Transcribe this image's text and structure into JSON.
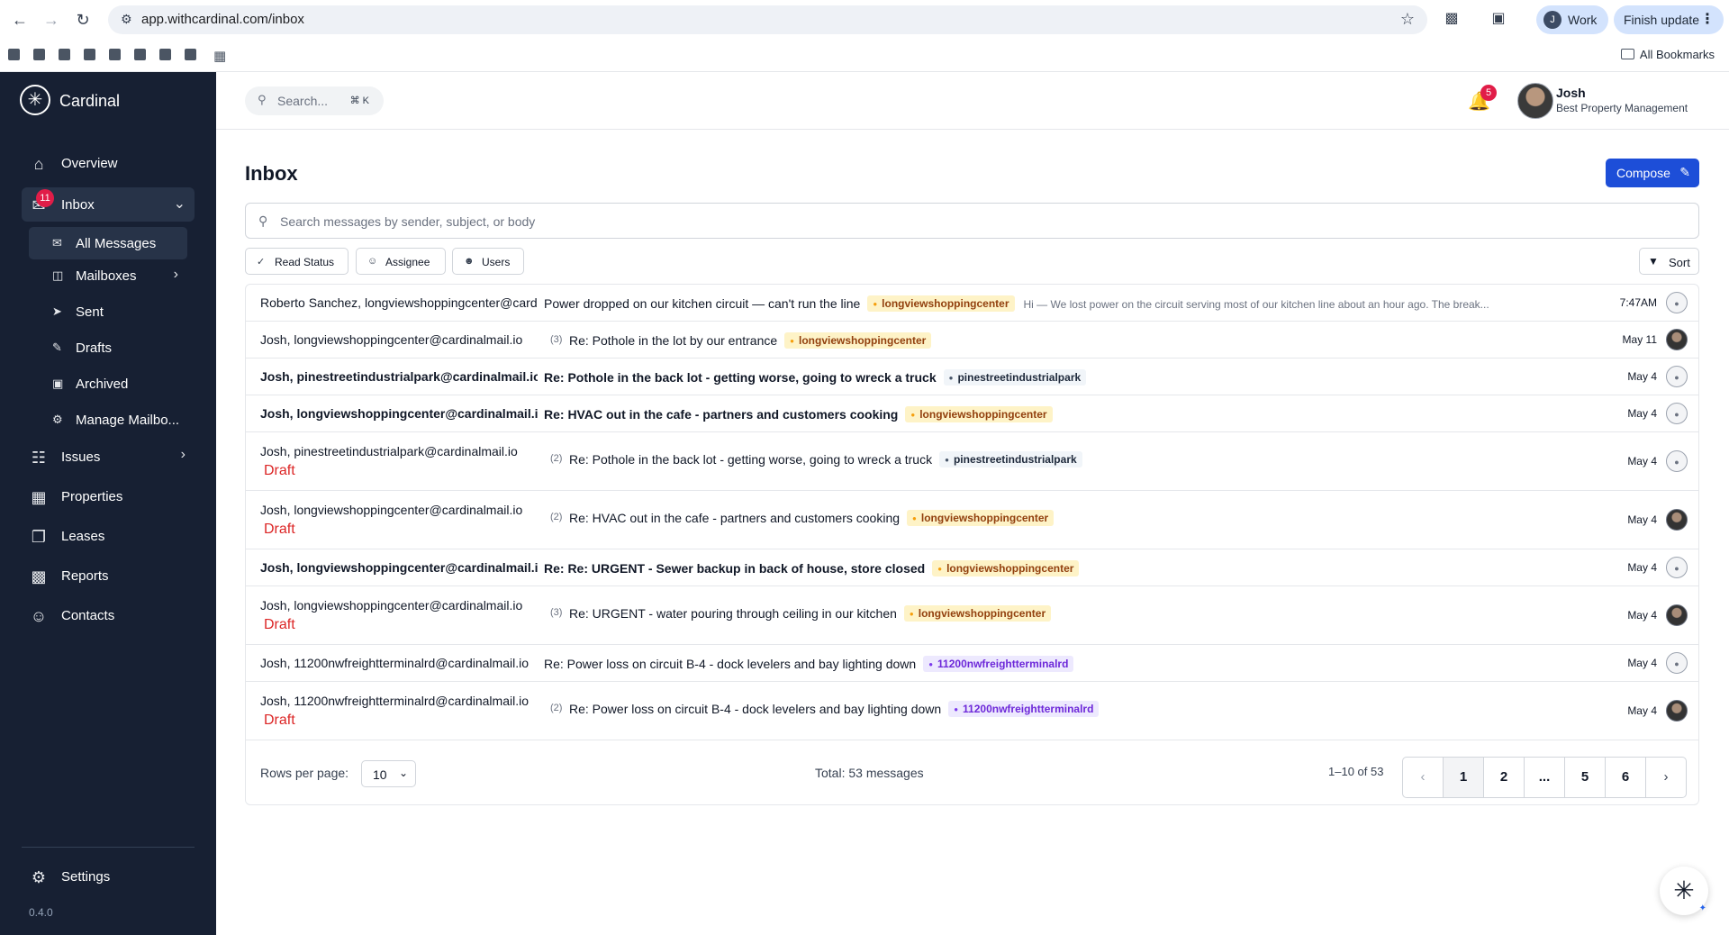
{
  "browser": {
    "url": "app.withcardinal.com/inbox",
    "profile_initial": "J",
    "profile_label": "Work",
    "update_label": "Finish update",
    "all_bookmarks": "All Bookmarks"
  },
  "sidebar": {
    "brand": "Cardinal",
    "overview": "Overview",
    "inbox": "Inbox",
    "inbox_badge": "11",
    "sub": {
      "all_messages": "All Messages",
      "mailboxes": "Mailboxes",
      "sent": "Sent",
      "drafts": "Drafts",
      "archived": "Archived",
      "manage": "Manage Mailbo..."
    },
    "issues": "Issues",
    "properties": "Properties",
    "leases": "Leases",
    "reports": "Reports",
    "contacts": "Contacts",
    "settings": "Settings",
    "version": "0.4.0"
  },
  "header": {
    "search_placeholder": "Search...",
    "shortcut": "⌘ K",
    "notif_count": "5",
    "user_name": "Josh",
    "user_org": "Best Property Management"
  },
  "inbox": {
    "title": "Inbox",
    "compose": "Compose",
    "search_placeholder": "Search messages by sender, subject, or body",
    "filters": {
      "read_status": "Read Status",
      "assignee": "Assignee",
      "users": "Users"
    },
    "sort": "Sort",
    "draft_label": "Draft",
    "messages": [
      {
        "sender": "Roberto Sanchez, longviewshoppingcenter@cardinalmail.io",
        "count": "",
        "subject": "Power dropped on our kitchen circuit — can't run the line",
        "tag": "longviewshoppingcenter",
        "preview": "Hi — We lost power on the circuit serving most of our kitchen line about an hour ago. The break...",
        "date": "7:47AM"
      },
      {
        "sender": "Josh, longviewshoppingcenter@cardinalmail.io",
        "count": "(3)",
        "subject": "Re: Pothole in the lot by our entrance",
        "tag": "longviewshoppingcenter",
        "preview": "",
        "date": "May 11"
      },
      {
        "sender": "Josh, pinestreetindustrialpark@cardinalmail.io",
        "count": "",
        "subject": "Re: Pothole in the back lot - getting worse, going to wreck a truck",
        "tag": "pinestreetindustrialpark",
        "preview": "",
        "date": "May 4"
      },
      {
        "sender": "Josh, longviewshoppingcenter@cardinalmail.io",
        "count": "",
        "subject": "Re: HVAC out in the cafe - partners and customers cooking",
        "tag": "longviewshoppingcenter",
        "preview": "",
        "date": "May 4"
      },
      {
        "sender": "Josh, pinestreetindustrialpark@cardinalmail.io",
        "count": "(2)",
        "subject": "Re: Pothole in the back lot - getting worse, going to wreck a truck",
        "tag": "pinestreetindustrialpark",
        "preview": "",
        "date": "May 4"
      },
      {
        "sender": "Josh, longviewshoppingcenter@cardinalmail.io",
        "count": "(2)",
        "subject": "Re: HVAC out in the cafe - partners and customers cooking",
        "tag": "longviewshoppingcenter",
        "preview": "",
        "date": "May 4"
      },
      {
        "sender": "Josh, longviewshoppingcenter@cardinalmail.io",
        "count": "",
        "subject": "Re: Re: URGENT - Sewer backup in back of house, store closed",
        "tag": "longviewshoppingcenter",
        "preview": "",
        "date": "May 4"
      },
      {
        "sender": "Josh, longviewshoppingcenter@cardinalmail.io",
        "count": "(3)",
        "subject": "Re: URGENT - water pouring through ceiling in our kitchen",
        "tag": "longviewshoppingcenter",
        "preview": "",
        "date": "May 4"
      },
      {
        "sender": "Josh, 11200nwfreightterminalrd@cardinalmail.io",
        "count": "",
        "subject": "Re: Power loss on circuit B-4 - dock levelers and bay lighting down",
        "tag": "11200nwfreightterminalrd",
        "preview": "",
        "date": "May 4"
      },
      {
        "sender": "Josh, 11200nwfreightterminalrd@cardinalmail.io",
        "count": "(2)",
        "subject": "Re: Power loss on circuit B-4 - dock levelers and bay lighting down",
        "tag": "11200nwfreightterminalrd",
        "preview": "",
        "date": "May 4"
      }
    ],
    "footer": {
      "rows_per_page_label": "Rows per page:",
      "rows_per_page": "10",
      "total": "Total: 53 messages",
      "range": "1–10 of 53",
      "pages": [
        "1",
        "2",
        "...",
        "5",
        "6"
      ]
    }
  }
}
